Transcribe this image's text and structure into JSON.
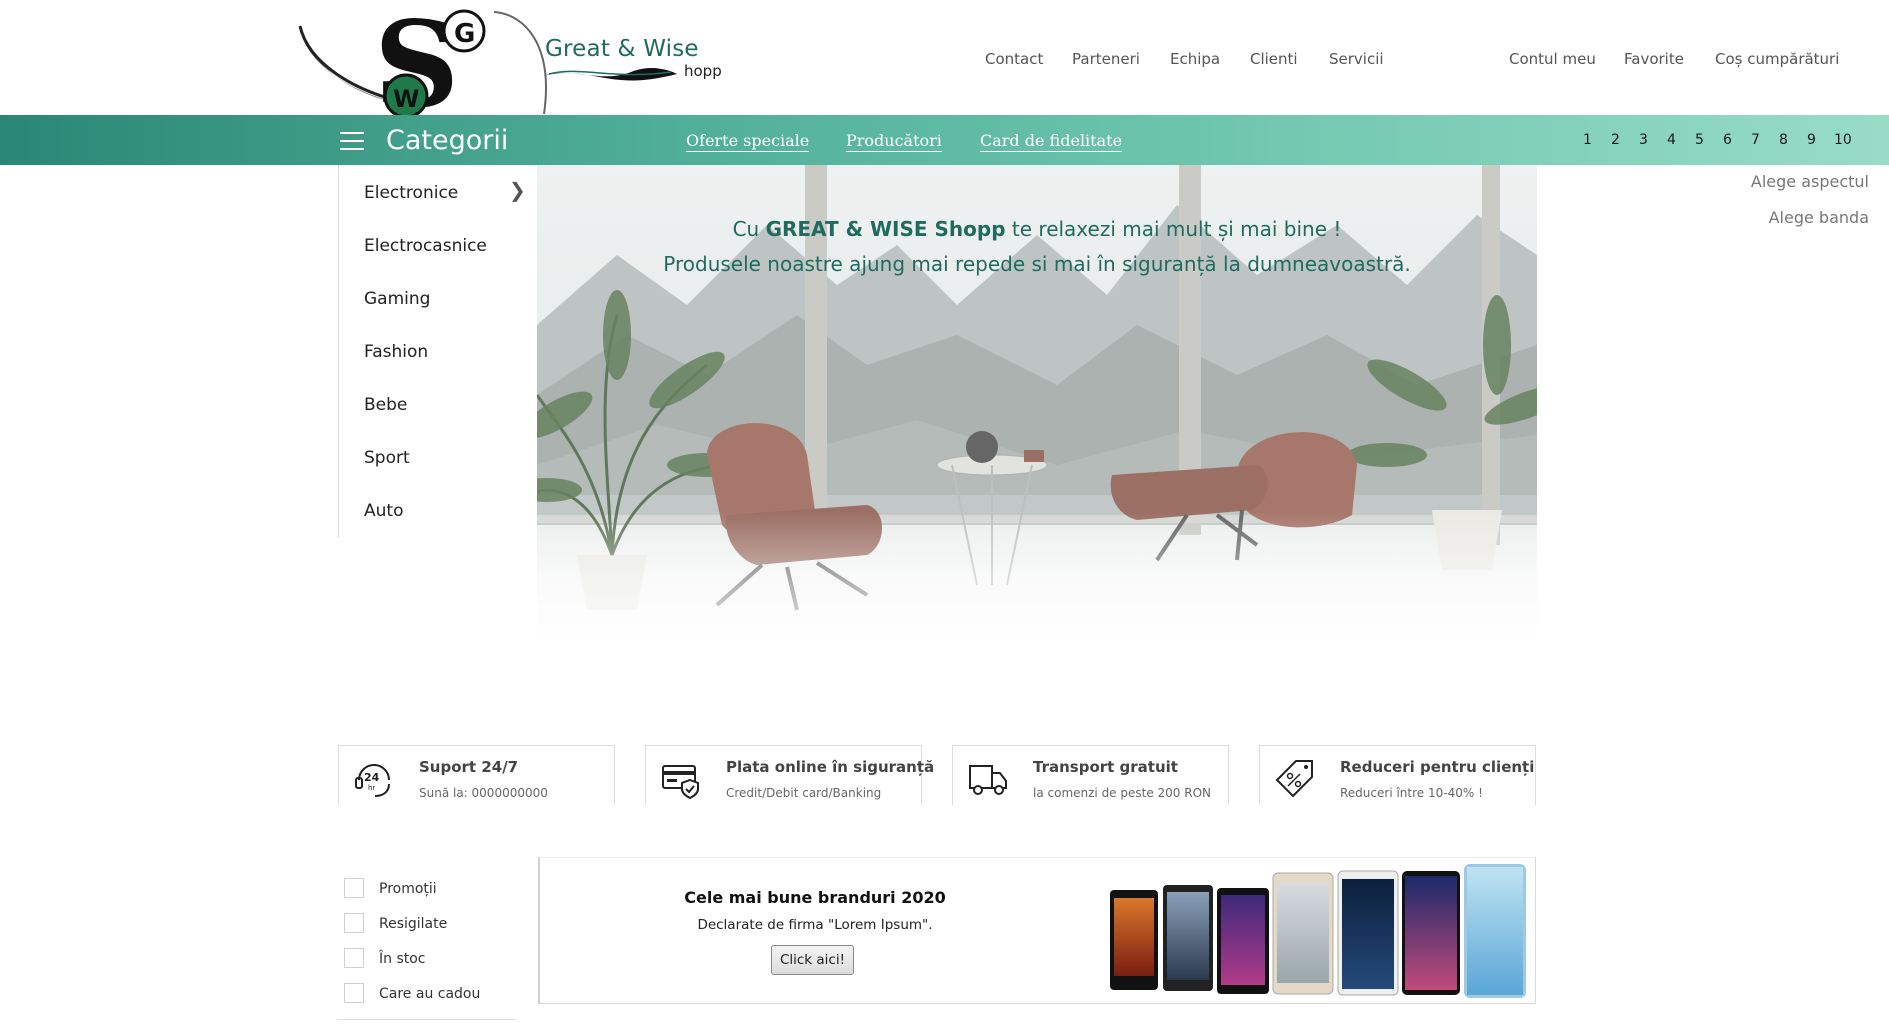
{
  "logo": {
    "letters": [
      "S",
      "G",
      "W"
    ]
  },
  "brand": {
    "title": "Great & Wise",
    "suffix": "hopp"
  },
  "topnav": {
    "left": [
      "Contact",
      "Parteneri",
      "Echipa",
      "Clienti",
      "Servicii"
    ],
    "right": [
      "Contul meu",
      "Favorite",
      "Coș cumpărături"
    ]
  },
  "bar": {
    "categories_label": "Categorii",
    "links": [
      "Oferte speciale",
      "Producători",
      "Card de fidelitate"
    ],
    "pages": [
      "1",
      "2",
      "3",
      "4",
      "5",
      "6",
      "7",
      "8",
      "9",
      "10"
    ]
  },
  "side_options": [
    "Alege aspectul",
    "Alege banda"
  ],
  "categories": [
    "Electronice",
    "Electrocasnice",
    "Gaming",
    "Fashion",
    "Bebe",
    "Sport",
    "Auto"
  ],
  "hero": {
    "line1_pre": "Cu ",
    "line1_brand": "GREAT & WISE Shopp",
    "line1_post": " te relaxezi mai mult și mai bine !",
    "line2": "Produsele noastre ajung mai repede si mai în siguranță la dumneavoastră."
  },
  "features": [
    {
      "icon": "support-24-icon",
      "title": "Suport 24/7",
      "sub": "Sună la: 0000000000"
    },
    {
      "icon": "card-shield-icon",
      "title": "Plata online în siguranță",
      "sub": "Credit/Debit card/Banking"
    },
    {
      "icon": "truck-icon",
      "title": "Transport gratuit",
      "sub": "la comenzi de peste 200 RON"
    },
    {
      "icon": "discount-tag-icon",
      "title": "Reduceri pentru clienți",
      "sub": "Reduceri între 10-40% !"
    }
  ],
  "filters": [
    "Promoții",
    "Resigilate",
    "În stoc",
    "Care au cadou"
  ],
  "promo": {
    "title": "Cele mai bune branduri 2020",
    "subtitle": "Declarate de firma \"Lorem Ipsum\".",
    "button": "Click aici!"
  },
  "colors": {
    "brand_green": "#1f6b5e",
    "bar_start": "#2a8775",
    "bar_end": "#98dcc6"
  }
}
